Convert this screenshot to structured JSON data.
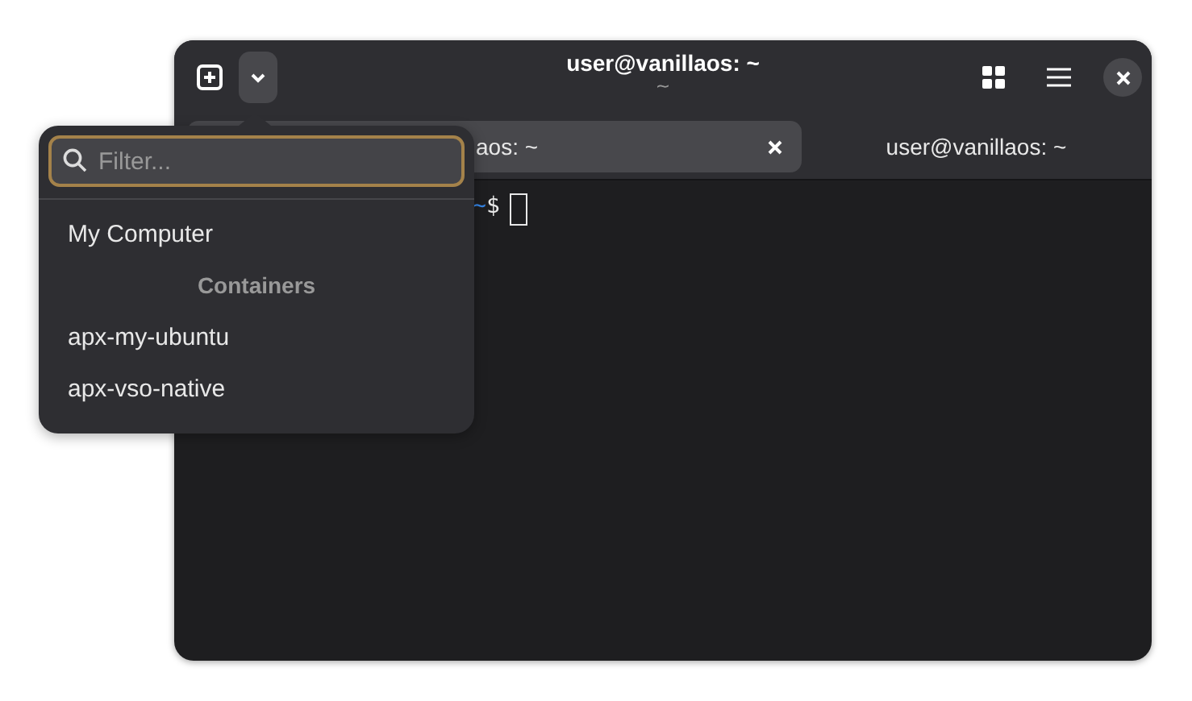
{
  "window": {
    "title": "user@vanillaos: ~",
    "subtitle": "~"
  },
  "tabs": [
    {
      "label": "aos: ~",
      "selected": true,
      "closable": true
    },
    {
      "label": "user@vanillaos: ~",
      "selected": false,
      "closable": false
    }
  ],
  "terminal": {
    "path": "~",
    "symbol": "$"
  },
  "popover": {
    "search": {
      "placeholder": "Filter..."
    },
    "items": [
      {
        "kind": "item",
        "label": "My Computer"
      },
      {
        "kind": "header",
        "label": "Containers"
      },
      {
        "kind": "item",
        "label": "apx-my-ubuntu"
      },
      {
        "kind": "item",
        "label": "apx-vso-native"
      }
    ]
  }
}
